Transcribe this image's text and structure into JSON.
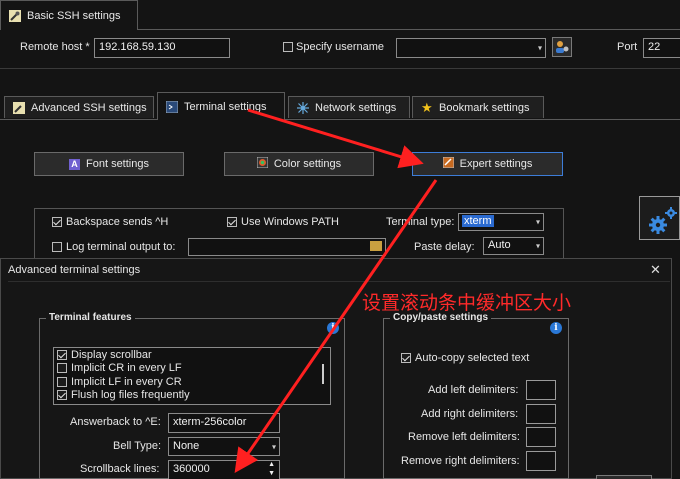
{
  "main_tabs": {
    "basic_ssh": "Basic SSH settings"
  },
  "basic": {
    "remote_host_label": "Remote host *",
    "remote_host_value": "192.168.59.130",
    "specify_username_label": "Specify username",
    "port_label": "Port",
    "port_value": "22"
  },
  "sub_tabs": [
    {
      "label": "Advanced SSH settings"
    },
    {
      "label": "Terminal settings"
    },
    {
      "label": "Network settings"
    },
    {
      "label": "Bookmark settings"
    }
  ],
  "terminal_buttons": {
    "font": "Font settings",
    "color": "Color settings",
    "expert": "Expert settings"
  },
  "terminal_options": {
    "backspace": "Backspace sends ^H",
    "windows_path": "Use Windows PATH",
    "terminal_type_label": "Terminal type:",
    "terminal_type_value": "xterm",
    "log_output": "Log terminal output to:",
    "paste_delay_label": "Paste delay:",
    "paste_delay_value": "Auto"
  },
  "dialog": {
    "title": "Advanced terminal settings",
    "close_glyph": "✕",
    "features_title": "Terminal features",
    "features": [
      {
        "label": "Display scrollbar",
        "checked": true
      },
      {
        "label": "Implicit CR in every LF",
        "checked": false
      },
      {
        "label": "Implicit LF in every CR",
        "checked": false
      },
      {
        "label": "Flush log files frequently",
        "checked": true
      }
    ],
    "answerback_label": "Answerback to ^E:",
    "answerback_value": "xterm-256color",
    "bell_label": "Bell Type:",
    "bell_value": "None",
    "scrollback_label": "Scrollback lines:",
    "scrollback_value": "360000",
    "copy_title": "Copy/paste settings",
    "autocopy_label": "Auto-copy selected text",
    "delimiters": [
      {
        "label": "Add left delimiters:"
      },
      {
        "label": "Add right delimiters:"
      },
      {
        "label": "Remove left delimiters:"
      },
      {
        "label": "Remove right delimiters:"
      }
    ],
    "info_glyph": "i"
  },
  "annotation": {
    "text": "设置滚动条中缓冲区大小",
    "color": "#ff2a2a"
  }
}
